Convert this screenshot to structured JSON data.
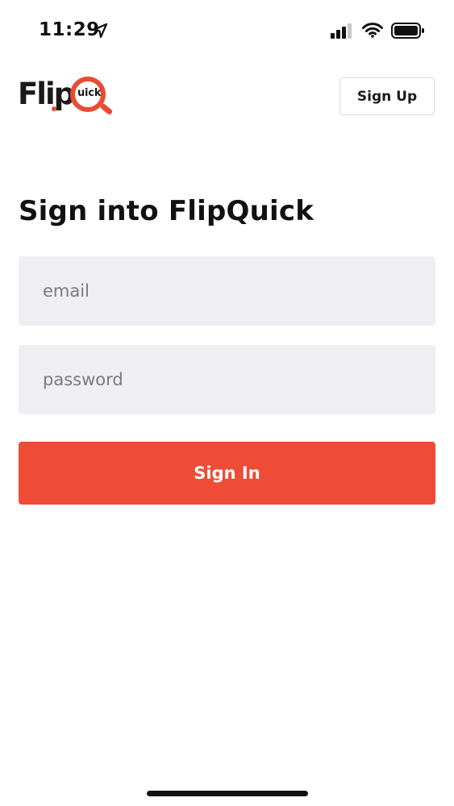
{
  "status_bar": {
    "time": "11:29",
    "icons": [
      "location-arrow-icon",
      "cellular-signal-icon",
      "wifi-icon",
      "battery-icon"
    ]
  },
  "header": {
    "logo": {
      "text_main": "Flip",
      "text_inner": "uick",
      "brand_color": "#e84c34"
    },
    "signup_label": "Sign Up"
  },
  "form": {
    "title": "Sign into FlipQuick",
    "email_placeholder": "email",
    "email_value": "",
    "password_placeholder": "password",
    "password_value": "",
    "signin_label": "Sign In"
  },
  "colors": {
    "accent": "#ee4c36",
    "field_background": "#efeef2",
    "text": "#111111"
  }
}
